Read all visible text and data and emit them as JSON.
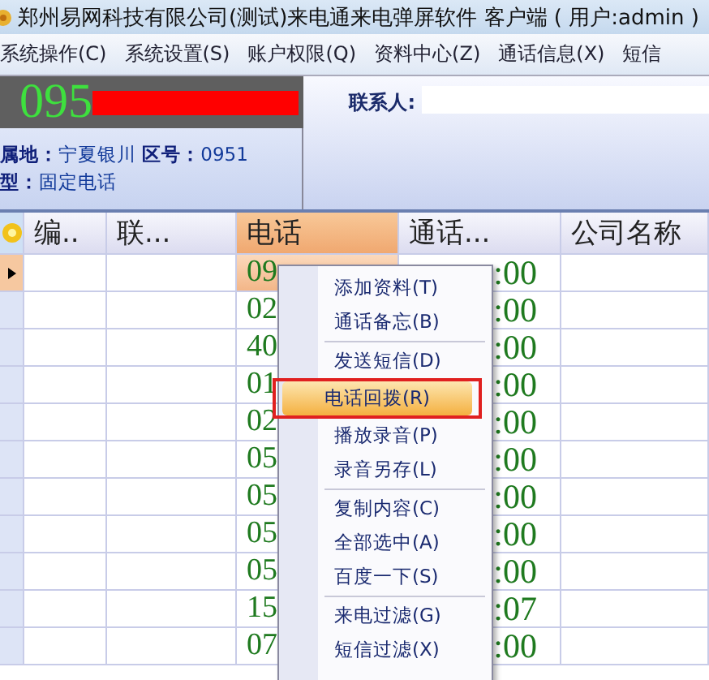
{
  "window": {
    "title": "郑州易网科技有限公司(测试)来电通来电弹屏软件 客户端 ( 用户:admin )"
  },
  "menubar": [
    "系统操作(C)",
    "系统设置(S)",
    "账户权限(Q)",
    "资料中心(Z)",
    "通话信息(X)",
    "短信"
  ],
  "caller": {
    "number": "095",
    "info": [
      "**属地：**宁夏银川 **区号：**0951",
      "**型：**固定电话"
    ]
  },
  "contact": {
    "label": "联系人:"
  },
  "table": {
    "columns": [
      "编..",
      "联...",
      "电话",
      "通话...",
      "公司名称"
    ],
    "rows": [
      {
        "selected": true,
        "phone": "09",
        "duration": ":00"
      },
      {
        "selected": false,
        "phone": "02",
        "duration": ":00"
      },
      {
        "selected": false,
        "phone": "40",
        "duration": ":00"
      },
      {
        "selected": false,
        "phone": "01",
        "duration": ":00"
      },
      {
        "selected": false,
        "phone": "02",
        "duration": ":00"
      },
      {
        "selected": false,
        "phone": "05",
        "duration": ":00"
      },
      {
        "selected": false,
        "phone": "05",
        "duration": ":00"
      },
      {
        "selected": false,
        "phone": "05",
        "duration": ":00"
      },
      {
        "selected": false,
        "phone": "05",
        "duration": ":00"
      },
      {
        "selected": false,
        "phone": "15",
        "duration": ":07"
      },
      {
        "selected": false,
        "phone": "07",
        "duration": ":00"
      }
    ]
  },
  "context_menu": [
    [
      {
        "text": "添加资料(T)",
        "selected": false
      },
      {
        "text": "通话备忘(B)",
        "selected": false
      }
    ],
    [
      {
        "text": "发送短信(D)",
        "selected": false
      },
      {
        "text": "电话回拨(R)",
        "selected": true
      },
      {
        "text": "播放录音(P)",
        "selected": false
      },
      {
        "text": "录音另存(L)",
        "selected": false
      }
    ],
    [
      {
        "text": "复制内容(C)",
        "selected": false
      },
      {
        "text": "全部选中(A)",
        "selected": false
      },
      {
        "text": "百度一下(S)",
        "selected": false
      }
    ],
    [
      {
        "text": "来电过滤(G)",
        "selected": false
      },
      {
        "text": "短信过滤(X)",
        "selected": false
      }
    ]
  ]
}
